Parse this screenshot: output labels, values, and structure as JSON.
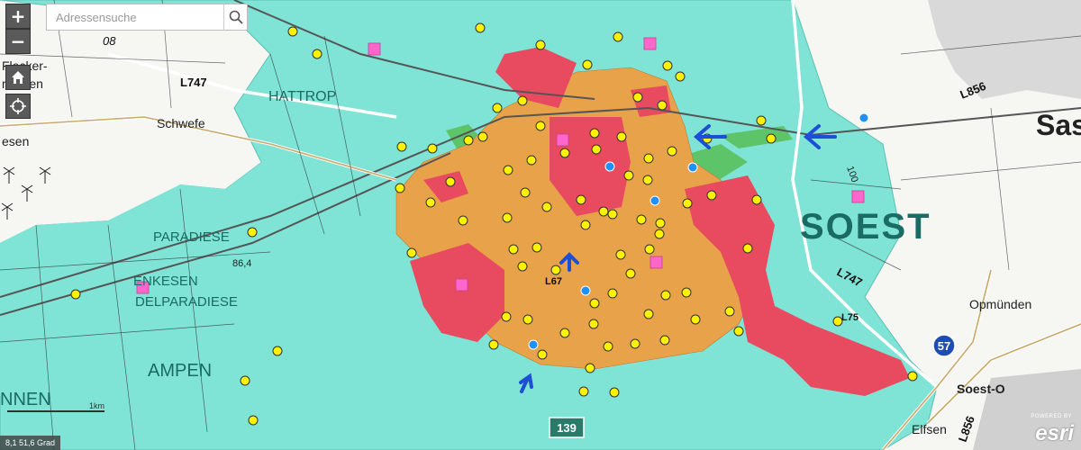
{
  "map": {
    "place_labels": [
      {
        "text": "HATTROP"
      },
      {
        "text": "Schwefe"
      },
      {
        "text": "PARADIESE"
      },
      {
        "text": "ENKESEN"
      },
      {
        "text": "DELPARADIESE"
      },
      {
        "text": "AMPEN"
      },
      {
        "text": "NNEN"
      },
      {
        "text": "SOEST"
      },
      {
        "text": "Opmünden"
      },
      {
        "text": "Soest-O"
      },
      {
        "text": "Elfsen"
      },
      {
        "text": "Sas"
      },
      {
        "text": "Flecker-"
      },
      {
        "text": "mühlen"
      },
      {
        "text": "esen"
      }
    ],
    "road_labels": [
      {
        "text": "L747"
      },
      {
        "text": "L747"
      },
      {
        "text": "L856"
      },
      {
        "text": "L856"
      },
      {
        "text": "08"
      },
      {
        "text": "L67"
      },
      {
        "text": "L75"
      }
    ],
    "shields": [
      {
        "text": "57"
      },
      {
        "text": "139"
      }
    ],
    "misc_labels": [
      {
        "text": "86,4"
      },
      {
        "text": "100"
      }
    ],
    "colors": {
      "water": "#7fe3d6",
      "urban_red": "#e84a5f",
      "urban_orange": "#e8a24a",
      "forest": "#5ec46a",
      "poi_yellow": "#fff200",
      "poi_blue": "#1e90ff",
      "poi_pink": "#ff66cc",
      "arrow_blue": "#1c4fd4"
    }
  },
  "controls": {
    "zoom_in": "+",
    "zoom_out": "−",
    "search_placeholder": "Adressensuche"
  },
  "scalebar": {
    "label": "1km"
  },
  "coordinates": {
    "text": "8,1 51,6 Grad"
  },
  "attribution": {
    "powered_by": "POWERED BY",
    "logo": "esri"
  }
}
